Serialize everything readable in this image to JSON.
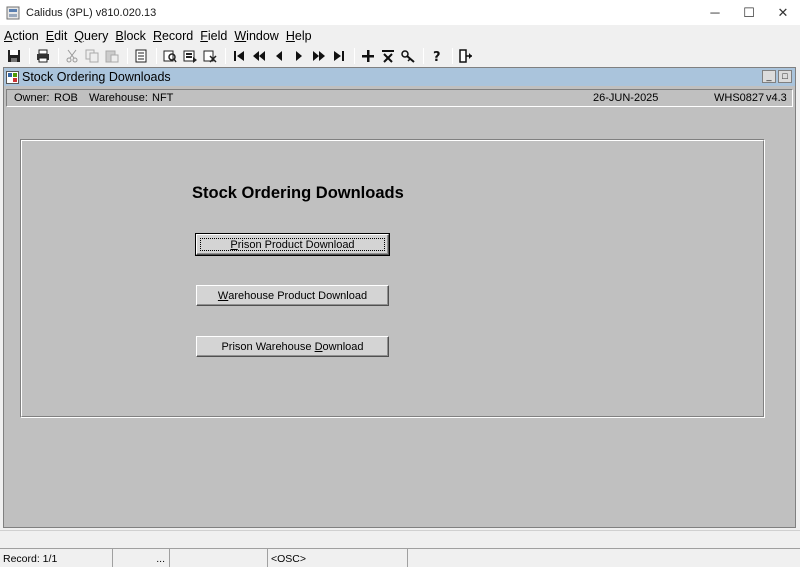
{
  "window": {
    "title": "Calidus (3PL) v810.020.13",
    "minimize_glyph": "─",
    "maximize_glyph": "☐",
    "close_glyph": "✕"
  },
  "menu": [
    {
      "label": "Action",
      "mnemonic": "A",
      "rest": "ction"
    },
    {
      "label": "Edit",
      "mnemonic": "E",
      "rest": "dit"
    },
    {
      "label": "Query",
      "mnemonic": "Q",
      "rest": "uery"
    },
    {
      "label": "Block",
      "mnemonic": "B",
      "rest": "lock"
    },
    {
      "label": "Record",
      "mnemonic": "R",
      "rest": "ecord"
    },
    {
      "label": "Field",
      "mnemonic": "F",
      "rest": "ield"
    },
    {
      "label": "Window",
      "mnemonic": "W",
      "rest": "indow"
    },
    {
      "label": "Help",
      "mnemonic": "H",
      "rest": "elp"
    }
  ],
  "toolbar": {
    "icons": [
      "save-icon",
      "print-icon",
      "cut-icon",
      "copy-icon",
      "paste-icon",
      "clear-form-icon",
      "enter-query-icon",
      "execute-query-icon",
      "cancel-query-icon",
      "first-record-icon",
      "previous-block-icon",
      "previous-record-icon",
      "next-record-icon",
      "next-block-icon",
      "last-record-icon",
      "insert-record-icon",
      "delete-record-icon",
      "lock-record-icon",
      "help-icon",
      "exit-icon"
    ]
  },
  "form": {
    "title": "Stock Ordering Downloads",
    "min_glyph": "_",
    "max_glyph": "□",
    "owner_label": "Owner:",
    "owner_value": "ROB",
    "warehouse_label": "Warehouse:",
    "warehouse_value": "NFT",
    "date": "26-JUN-2025",
    "form_code": "WHS0827",
    "version": "v4.3",
    "heading": "Stock Ordering Downloads",
    "buttons": [
      {
        "pre": "",
        "mnemonic": "P",
        "post": "rison Product Download",
        "label": "Prison Product Download"
      },
      {
        "pre": "",
        "mnemonic": "W",
        "post": "arehouse Product Download",
        "label": "Warehouse Product Download"
      },
      {
        "pre": "Prison Warehouse ",
        "mnemonic": "D",
        "post": "ownload",
        "label": "Prison Warehouse Download"
      }
    ]
  },
  "status": {
    "record": "Record: 1/1",
    "ellipsis": "...",
    "mode": "<OSC>"
  }
}
